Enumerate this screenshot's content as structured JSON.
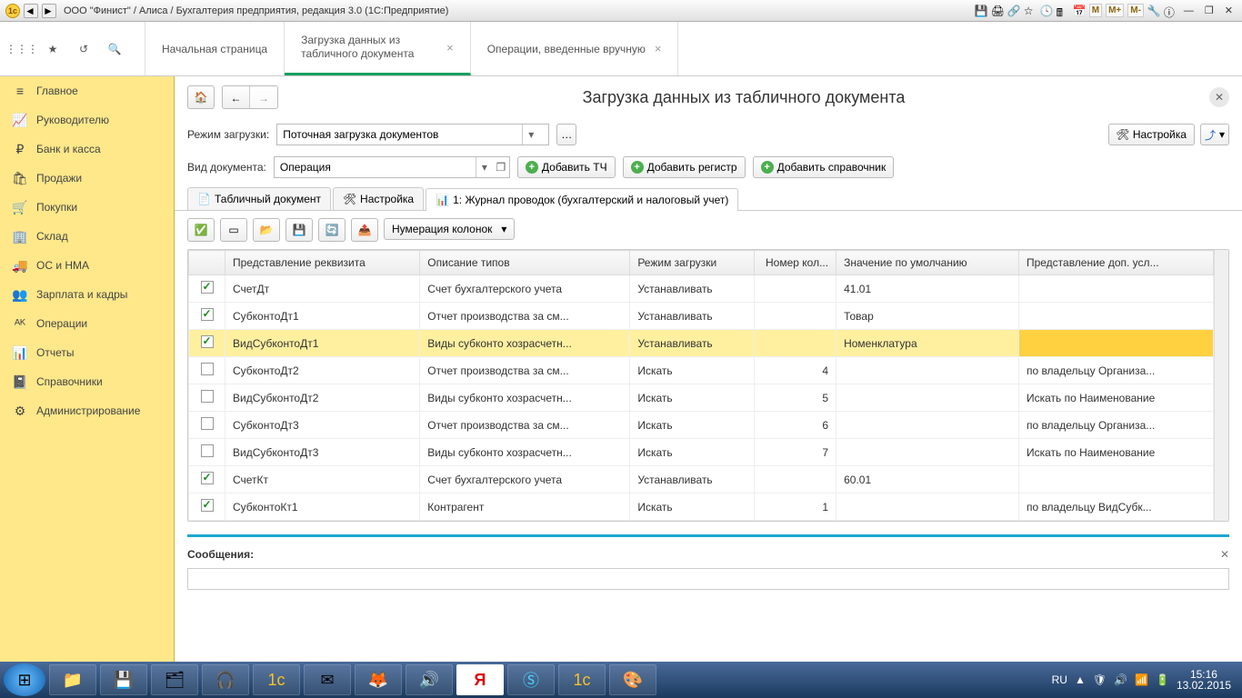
{
  "window": {
    "title": "ООО \"Финист\" / Алиса / Бухгалтерия предприятия, редакция 3.0  (1С:Предприятие)"
  },
  "topTabs": [
    {
      "label": "Начальная страница",
      "closable": false
    },
    {
      "label": "Загрузка данных из табличного документа",
      "closable": true,
      "active": true
    },
    {
      "label": "Операции, введенные вручную",
      "closable": true
    }
  ],
  "sidebar": {
    "items": [
      {
        "icon": "≡",
        "label": "Главное"
      },
      {
        "icon": "📈",
        "label": "Руководителю"
      },
      {
        "icon": "₽",
        "label": "Банк и касса"
      },
      {
        "icon": "🛍",
        "label": "Продажи"
      },
      {
        "icon": "🛒",
        "label": "Покупки"
      },
      {
        "icon": "🏢",
        "label": "Склад"
      },
      {
        "icon": "🚚",
        "label": "ОС и НМА"
      },
      {
        "icon": "👥",
        "label": "Зарплата и кадры"
      },
      {
        "icon": "ᴬᴷ",
        "label": "Операции"
      },
      {
        "icon": "📊",
        "label": "Отчеты"
      },
      {
        "icon": "📓",
        "label": "Справочники"
      },
      {
        "icon": "⚙",
        "label": "Администрирование"
      }
    ]
  },
  "page": {
    "title": "Загрузка данных из табличного документа",
    "modeLabel": "Режим загрузки:",
    "modeValue": "Поточная загрузка документов",
    "docTypeLabel": "Вид документа:",
    "docTypeValue": "Операция",
    "addTCH": "Добавить ТЧ",
    "addReg": "Добавить регистр",
    "addRef": "Добавить справочник",
    "settingsBtn": "Настройка",
    "tabs2": [
      {
        "label": "Табличный документ"
      },
      {
        "label": "Настройка"
      },
      {
        "label": "1: Журнал проводок (бухгалтерский и налоговый учет)",
        "active": true
      }
    ],
    "numColsBtn": "Нумерация колонок"
  },
  "table": {
    "headers": [
      "",
      "Представление реквизита",
      "Описание типов",
      "Режим загрузки",
      "Номер кол...",
      "Значение по умолчанию",
      "Представление доп. усл..."
    ],
    "rows": [
      {
        "chk": true,
        "c1": "СчетДт",
        "c2": "Счет бухгалтерского учета",
        "c3": "Устанавливать",
        "c4": "",
        "c5": "41.01",
        "c6": ""
      },
      {
        "chk": true,
        "c1": "СубконтоДт1",
        "c2": "Отчет производства за см...",
        "c3": "Устанавливать",
        "c4": "",
        "c5": "Товар",
        "c6": ""
      },
      {
        "chk": true,
        "sel": true,
        "c1": "ВидСубконтоДт1",
        "c2": "Виды субконто хозрасчетн...",
        "c3": "Устанавливать",
        "c4": "",
        "c5": "Номенклатура",
        "c6": ""
      },
      {
        "chk": false,
        "c1": "СубконтоДт2",
        "c2": "Отчет производства за см...",
        "c3": "Искать",
        "c4": "4",
        "c5": "",
        "c6": "по владельцу Организа..."
      },
      {
        "chk": false,
        "c1": "ВидСубконтоДт2",
        "c2": "Виды субконто хозрасчетн...",
        "c3": "Искать",
        "c4": "5",
        "c5": "",
        "c6": "Искать по Наименование"
      },
      {
        "chk": false,
        "c1": "СубконтоДт3",
        "c2": "Отчет производства за см...",
        "c3": "Искать",
        "c4": "6",
        "c5": "",
        "c6": "по владельцу Организа..."
      },
      {
        "chk": false,
        "c1": "ВидСубконтоДт3",
        "c2": "Виды субконто хозрасчетн...",
        "c3": "Искать",
        "c4": "7",
        "c5": "",
        "c6": "Искать по Наименование"
      },
      {
        "chk": true,
        "c1": "СчетКт",
        "c2": "Счет бухгалтерского учета",
        "c3": "Устанавливать",
        "c4": "",
        "c5": "60.01",
        "c6": ""
      },
      {
        "chk": true,
        "c1": "СубконтоКт1",
        "c2": "Контрагент",
        "c3": "Искать",
        "c4": "1",
        "c5": "",
        "c6": "по владельцу ВидСубк..."
      }
    ]
  },
  "messages": {
    "label": "Сообщения:"
  },
  "tray": {
    "lang": "RU",
    "time": "15:16",
    "date": "13.02.2015"
  }
}
